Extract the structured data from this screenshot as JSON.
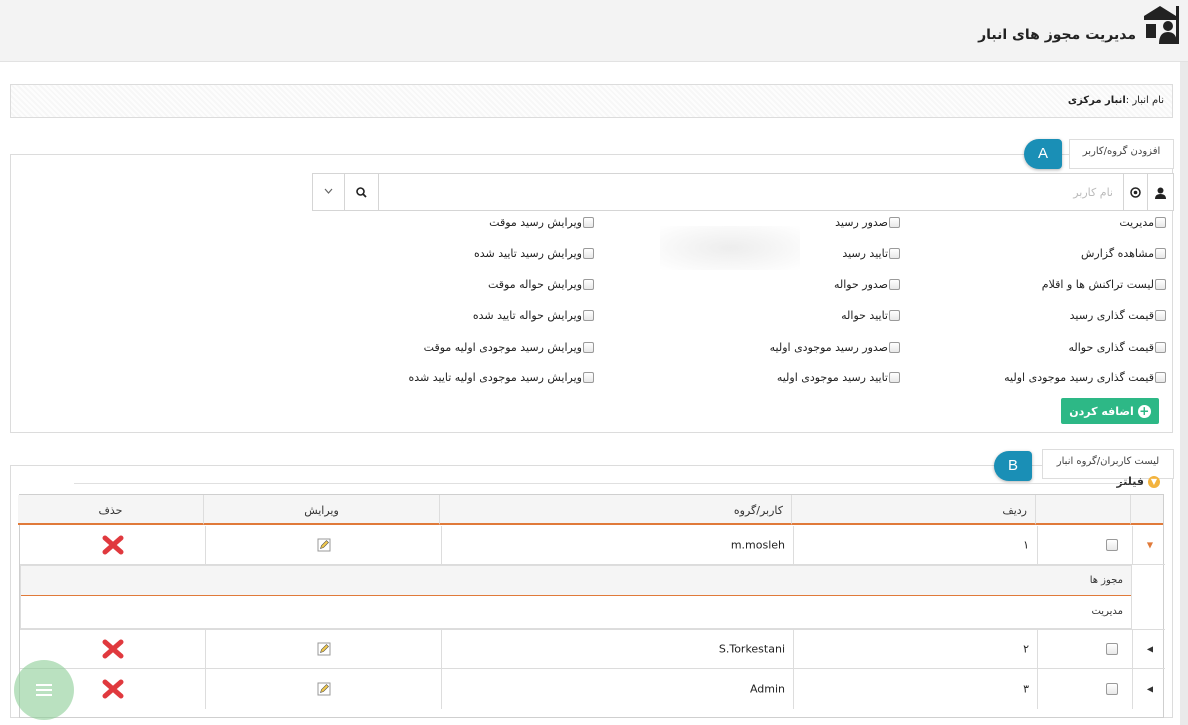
{
  "header": {
    "title": "مدیریت مجوز های انبار",
    "icon": "warehouse-user-icon"
  },
  "warehouse": {
    "label": "نام انبار :",
    "value": "انبار مرکزی"
  },
  "add_section": {
    "legend": "افزودن گروه/کاربر",
    "badge": "A",
    "search_placeholder": "نام کاربر",
    "icons": {
      "user": "user-icon",
      "target": "target-icon",
      "search": "search-icon",
      "dropdown": "chevron-down-icon"
    },
    "permissions_col1": [
      "مدیریت",
      "مشاهده گزارش",
      "لیست تراکنش ها و اقلام",
      "قیمت گذاری رسید",
      "قیمت گذاری حواله",
      "قیمت گذاری رسید موجودی اولیه"
    ],
    "permissions_col2": [
      "صدور رسید",
      "تایید رسید",
      "صدور حواله",
      "تایید حواله",
      "صدور رسید موجودی اولیه",
      "تایید رسید موجودی اولیه"
    ],
    "permissions_col3": [
      "ویرایش رسید موقت",
      "ویرایش رسید تایید شده",
      "ویرایش حواله موقت",
      "ویرایش حواله تایید شده",
      "ویرایش رسید موجودی اولیه موقت",
      "ویرایش رسید موجودی اولیه تایید شده"
    ],
    "add_button": "اضافه کردن"
  },
  "list_section": {
    "legend": "لیست کاربران/گروه انبار",
    "badge": "B",
    "filter_label": "فیلتر",
    "columns": {
      "row": "ردیف",
      "user": "کاربر/گروه",
      "edit": "ویرایش",
      "delete": "حذف"
    },
    "rows": [
      {
        "index": "۱",
        "user": "m.mosleh"
      },
      {
        "index": "۲",
        "user": "S.Torkestani"
      },
      {
        "index": "۳",
        "user": "Admin"
      }
    ],
    "sub_table": {
      "header": "مجوز ها",
      "value": "مدیریت"
    }
  },
  "colors": {
    "accent": "#2db886",
    "badge": "#1a8fb6",
    "header_underline": "#e07a3a",
    "delete": "#e0393e"
  }
}
